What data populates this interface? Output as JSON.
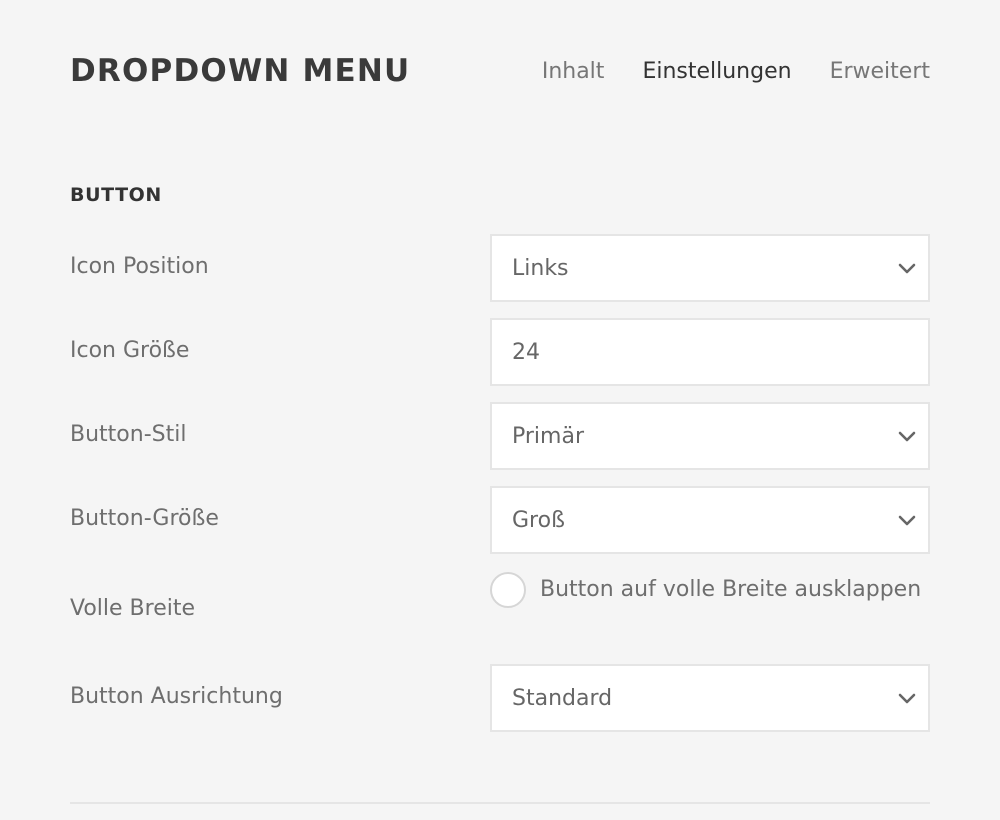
{
  "header": {
    "title": "DROPDOWN MENU",
    "tabs": [
      {
        "label": "Inhalt",
        "active": false
      },
      {
        "label": "Einstellungen",
        "active": true
      },
      {
        "label": "Erweitert",
        "active": false
      }
    ]
  },
  "section": {
    "heading": "BUTTON",
    "fields": {
      "icon_position": {
        "label": "Icon Position",
        "value": "Links"
      },
      "icon_size": {
        "label": "Icon Größe",
        "value": "24"
      },
      "button_style": {
        "label": "Button-Stil",
        "value": "Primär"
      },
      "button_size": {
        "label": "Button-Größe",
        "value": "Groß"
      },
      "full_width": {
        "label": "Volle Breite",
        "checkbox_label": "Button auf volle Breite ausklappen",
        "checked": false
      },
      "button_alignment": {
        "label": "Button Ausrichtung",
        "value": "Standard"
      }
    }
  },
  "icons": {
    "dropdown_chevron": "chevron-down-icon"
  },
  "colors": {
    "background": "#f5f5f5",
    "field_background": "#ffffff",
    "field_border": "#e5e5e5",
    "title": "#3a3a3a",
    "text": "#666666"
  }
}
